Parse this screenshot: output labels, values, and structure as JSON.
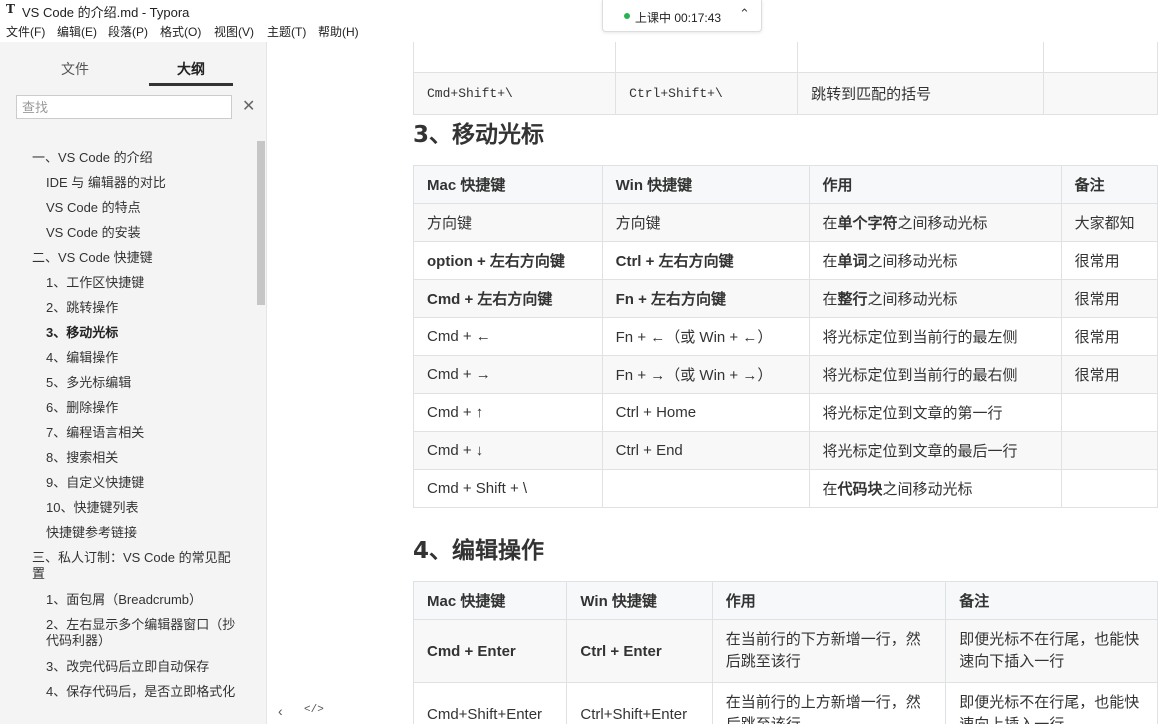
{
  "window": {
    "title": "VS Code 的介绍.md - Typora",
    "app_icon": "T"
  },
  "menu": [
    "文件(F)",
    "编辑(E)",
    "段落(P)",
    "格式(O)",
    "视图(V)",
    "主题(T)",
    "帮助(H)"
  ],
  "recording": {
    "label": "上课中 00:17:43"
  },
  "sidebar": {
    "tabs": [
      "文件",
      "大纲"
    ],
    "search_placeholder": "查找",
    "outline": [
      {
        "label": "一、VS Code 的介绍",
        "level": 1
      },
      {
        "label": "IDE 与 编辑器的对比",
        "level": 2
      },
      {
        "label": "VS Code 的特点",
        "level": 2
      },
      {
        "label": "VS Code 的安装",
        "level": 2
      },
      {
        "label": "二、VS Code 快捷键",
        "level": 1
      },
      {
        "label": "1、工作区快捷键",
        "level": 2
      },
      {
        "label": "2、跳转操作",
        "level": 2
      },
      {
        "label": "3、移动光标",
        "level": 2,
        "active": true
      },
      {
        "label": "4、编辑操作",
        "level": 2
      },
      {
        "label": "5、多光标编辑",
        "level": 2
      },
      {
        "label": "6、删除操作",
        "level": 2
      },
      {
        "label": "7、编程语言相关",
        "level": 2
      },
      {
        "label": "8、搜索相关",
        "level": 2
      },
      {
        "label": "9、自定义快捷键",
        "level": 2
      },
      {
        "label": "10、快捷键列表",
        "level": 2
      },
      {
        "label": "快捷键参考链接",
        "level": 2
      },
      {
        "label": "三、私人订制：VS Code 的常见配置",
        "level": 1
      },
      {
        "label": "1、面包屑（Breadcrumb）",
        "level": 2
      },
      {
        "label": "2、左右显示多个编辑器窗口（抄代码利器）",
        "level": 2
      },
      {
        "label": "3、改完代码后立即自动保存",
        "level": 2
      },
      {
        "label": "4、保存代码后，是否立即格式化",
        "level": 2
      }
    ]
  },
  "content": {
    "top_table_row": {
      "mac": "Cmd+Shift+\\",
      "win": "Ctrl+Shift+\\",
      "effect": "跳转到匹配的括号",
      "note": ""
    },
    "section3": {
      "heading": "3、移动光标",
      "headers": [
        "Mac 快捷键",
        "Win 快捷键",
        "作用",
        "备注"
      ],
      "rows": [
        {
          "mac": "方向键",
          "win": "方向键",
          "effect_pre": "在",
          "effect_bold": "单个字符",
          "effect_post": "之间移动光标",
          "note": "大家都知"
        },
        {
          "mac": "option + 左右方向键",
          "win": "Ctrl + 左右方向键",
          "effect_pre": "在",
          "effect_bold": "单词",
          "effect_post": "之间移动光标",
          "note": "很常用"
        },
        {
          "mac": "Cmd + 左右方向键",
          "win": "Fn + 左右方向键",
          "effect_pre": "在",
          "effect_bold": "整行",
          "effect_post": "之间移动光标",
          "note": "很常用"
        },
        {
          "mac": "Cmd + ←",
          "win": "Fn + ←（或 Win + ←）",
          "effect_pre": "将光标定位到当前行的最左侧",
          "effect_bold": "",
          "effect_post": "",
          "note": "很常用"
        },
        {
          "mac": "Cmd + →",
          "win": "Fn + →（或 Win + →）",
          "effect_pre": "将光标定位到当前行的最右侧",
          "effect_bold": "",
          "effect_post": "",
          "note": "很常用"
        },
        {
          "mac": "Cmd + ↑",
          "win": "Ctrl + Home",
          "effect_pre": "将光标定位到文章的第一行",
          "effect_bold": "",
          "effect_post": "",
          "note": ""
        },
        {
          "mac": "Cmd + ↓",
          "win": "Ctrl + End",
          "effect_pre": "将光标定位到文章的最后一行",
          "effect_bold": "",
          "effect_post": "",
          "note": ""
        },
        {
          "mac": "Cmd + Shift + \\",
          "win": "",
          "effect_pre": "在",
          "effect_bold": "代码块",
          "effect_post": "之间移动光标",
          "note": ""
        }
      ]
    },
    "section4": {
      "heading": "4、编辑操作",
      "headers": [
        "Mac 快捷键",
        "Win 快捷键",
        "作用",
        "备注"
      ],
      "rows": [
        {
          "mac": "Cmd + Enter",
          "win": "Ctrl + Enter",
          "effect": "在当前行的下方新增一行，然后跳至该行",
          "note": "即便光标不在行尾，也能快速向下插入一行"
        },
        {
          "mac": "Cmd+Shift+Enter",
          "win": "Ctrl+Shift+Enter",
          "effect": "在当前行的上方新增一行，然后跳至该行",
          "note": "即便光标不在行尾，也能快速向上插入一行"
        }
      ]
    }
  }
}
